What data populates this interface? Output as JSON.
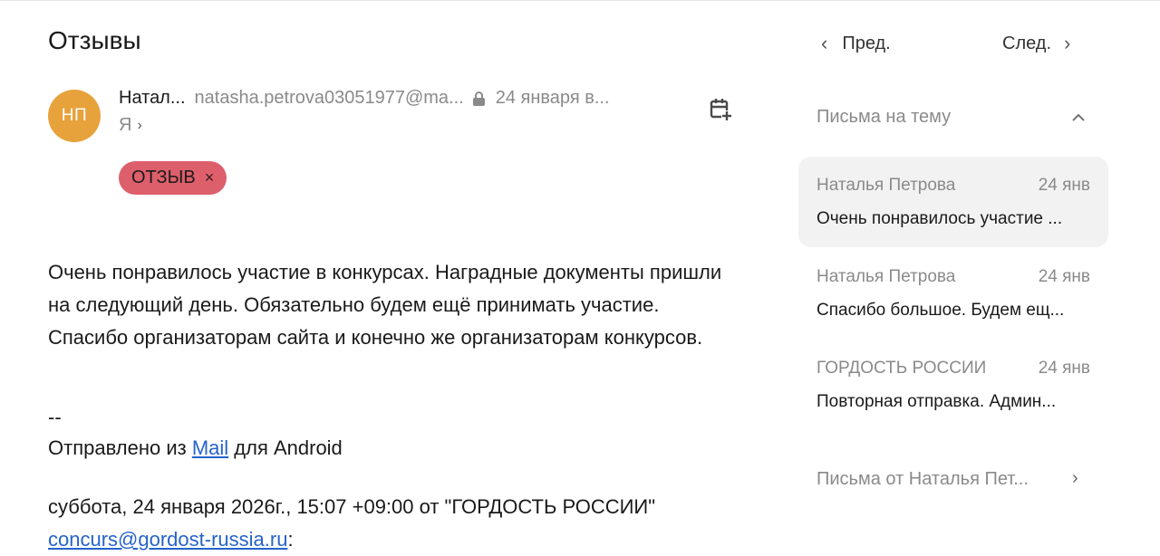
{
  "page_title": "Отзывы",
  "message": {
    "avatar_initials": "НП",
    "avatar_color": "#e8a23c",
    "sender_name": "Натал...",
    "sender_email": "natasha.petrova03051977@ma...",
    "date": "24 января в...",
    "recipient": "Я",
    "recipient_chevron": "›",
    "tag": {
      "label": "ОТЗЫВ",
      "remove": "×",
      "color": "#de5f6c"
    },
    "body": "Очень понравилось участие в конкурсах. Наградные документы пришли на следующий день. Обязательно будем ещё принимать участие. Спасибо организаторам сайта и конечно же организаторам конкурсов.",
    "signature_dash": "--",
    "sent_from_prefix": "Отправлено из ",
    "sent_from_link": "Mail",
    "sent_from_suffix": " для Android",
    "quote_header": "суббота, 24 января 2026г., 15:07 +09:00 от \"ГОРДОСТЬ РОССИИ\" ",
    "quote_email": "concurs@gordost-russia.ru",
    "quote_colon": ":"
  },
  "navigation": {
    "prev_label": "Пред.",
    "next_label": "След.",
    "prev_icon": "chevron-left-icon",
    "next_icon": "chevron-right-icon"
  },
  "thread": {
    "heading": "Письма на тему",
    "toggle": "^",
    "items": [
      {
        "from": "Наталья Петрова",
        "date": "24 янв",
        "subject": "Очень понравилось участие ...",
        "active": true
      },
      {
        "from": "Наталья Петрова",
        "date": "24 янв",
        "subject": "Спасибо большое. Будем ещ...",
        "active": false
      },
      {
        "from": "ГОРДОСТЬ РОССИИ",
        "date": "24 янв",
        "subject": "Повторная отправка. Админ...",
        "active": false
      }
    ]
  },
  "from_sender_link": "Письма от Наталья Пет...",
  "from_sender_chevron": "›",
  "icons": {
    "calendar_add": "calendar-add-icon",
    "lock": "lock-icon"
  },
  "link_color": "#2563c9"
}
